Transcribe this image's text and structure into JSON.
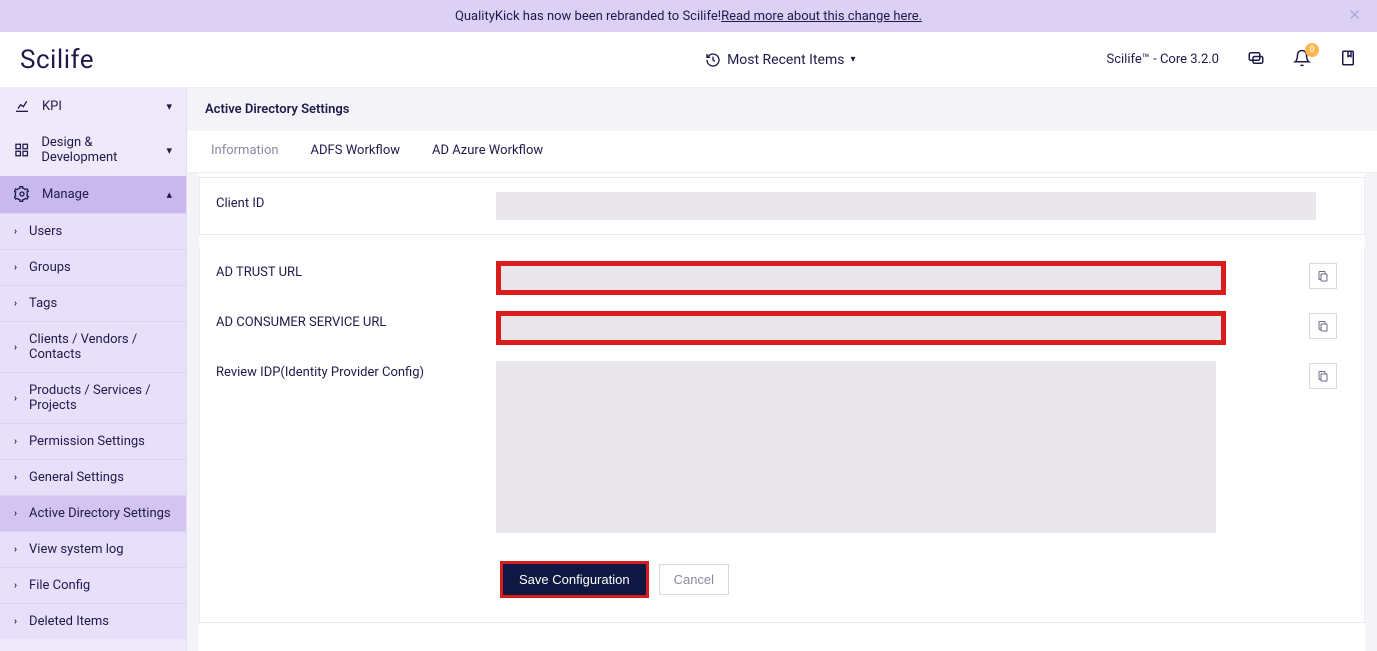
{
  "banner": {
    "text_prefix": "QualityKick has now been rebranded to Scilife! ",
    "link_text": "Read more about this change here."
  },
  "header": {
    "logo": "Scilife",
    "recent_label": "Most Recent Items",
    "version": "Scilife™ - Core 3.2.0",
    "notif_badge": "0"
  },
  "sidebar": {
    "kpi": "KPI",
    "design": "Design & Development",
    "manage": "Manage",
    "items": [
      "Users",
      "Groups",
      "Tags",
      "Clients / Vendors / Contacts",
      "Products / Services / Projects",
      "Permission Settings",
      "General Settings",
      "Active Directory Settings",
      "View system log",
      "File Config",
      "Deleted Items"
    ]
  },
  "page": {
    "title": "Active Directory Settings",
    "tabs": {
      "info": "Information",
      "adfs": "ADFS Workflow",
      "azure": "AD Azure Workflow"
    }
  },
  "form": {
    "client_id_label": "Client ID",
    "client_id_value": "",
    "trust_url_label": "AD TRUST URL",
    "trust_url_value": "",
    "consumer_url_label": "AD CONSUMER SERVICE URL",
    "consumer_url_value": "",
    "idp_label": "Review IDP(Identity Provider Config)",
    "idp_value": "",
    "save_label": "Save Configuration",
    "cancel_label": "Cancel"
  }
}
